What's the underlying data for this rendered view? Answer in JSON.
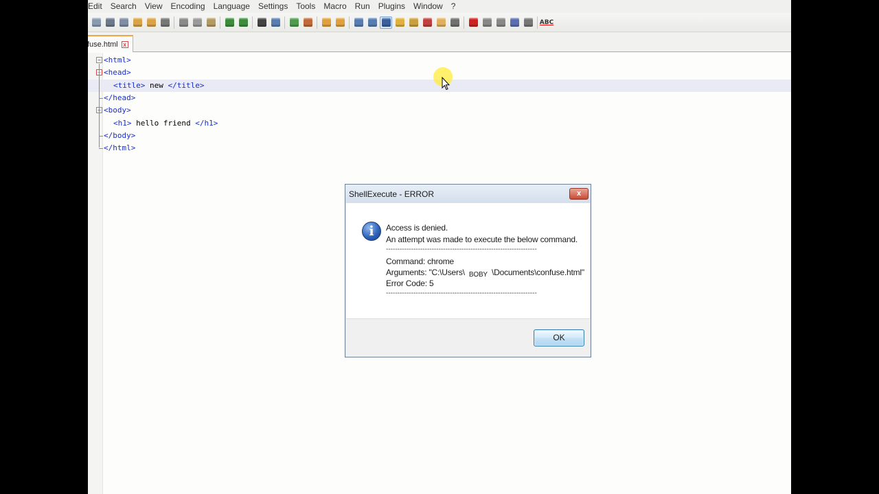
{
  "menu": {
    "items": [
      "Edit",
      "Search",
      "View",
      "Encoding",
      "Language",
      "Settings",
      "Tools",
      "Macro",
      "Run",
      "Plugins",
      "Window",
      "?"
    ]
  },
  "toolbar": {
    "buttons": [
      {
        "icon": "new-file-icon",
        "color": "#8a9bb0"
      },
      {
        "icon": "save-icon",
        "color": "#6c7a8c"
      },
      {
        "icon": "save-all-icon",
        "color": "#7f8ea2"
      },
      {
        "icon": "close-file-icon",
        "color": "#d9a34a"
      },
      {
        "icon": "close-all-icon",
        "color": "#d9a34a"
      },
      {
        "icon": "print-icon",
        "color": "#777777"
      },
      {
        "sep": true
      },
      {
        "icon": "cut-icon",
        "color": "#8a8a8a"
      },
      {
        "icon": "copy-icon",
        "color": "#9a9a9a"
      },
      {
        "icon": "paste-icon",
        "color": "#b59a62"
      },
      {
        "sep": true
      },
      {
        "icon": "undo-icon",
        "color": "#3d8c3d"
      },
      {
        "icon": "redo-icon",
        "color": "#3d8c3d"
      },
      {
        "sep": true
      },
      {
        "icon": "find-icon",
        "color": "#444444"
      },
      {
        "icon": "replace-icon",
        "color": "#5a7db0"
      },
      {
        "sep": true
      },
      {
        "icon": "zoom-in-icon",
        "color": "#4f9a4f"
      },
      {
        "icon": "zoom-out-icon",
        "color": "#c06a3a"
      },
      {
        "sep": true
      },
      {
        "icon": "sync-vertical-icon",
        "color": "#e0a040"
      },
      {
        "icon": "sync-horizontal-icon",
        "color": "#e0a040"
      },
      {
        "sep": true
      },
      {
        "icon": "word-wrap-icon",
        "color": "#5a7db0"
      },
      {
        "icon": "show-all-chars-icon",
        "color": "#5a7db0"
      },
      {
        "icon": "indent-guide-icon",
        "color": "#3a5f9a",
        "active": true
      },
      {
        "icon": "user-language-icon",
        "color": "#e0b040"
      },
      {
        "icon": "doc-map-icon",
        "color": "#c9a040"
      },
      {
        "icon": "function-list-icon",
        "color": "#c04040"
      },
      {
        "icon": "folder-workspace-icon",
        "color": "#e0b060"
      },
      {
        "icon": "monitoring-icon",
        "color": "#707070"
      },
      {
        "sep": true
      },
      {
        "icon": "record-macro-icon",
        "color": "#cc2222"
      },
      {
        "icon": "stop-macro-icon",
        "color": "#888888"
      },
      {
        "icon": "play-macro-icon",
        "color": "#888888"
      },
      {
        "icon": "run-macro-multiple-icon",
        "color": "#5a6fb0"
      },
      {
        "icon": "save-macro-icon",
        "color": "#777777"
      },
      {
        "sep": true
      },
      {
        "icon": "spell-check-icon",
        "text": "ABC"
      }
    ]
  },
  "tab": {
    "label": "fuse.html",
    "close": "x"
  },
  "editor": {
    "lines": [
      {
        "indent": false,
        "parts": [
          [
            "tag",
            "<html>"
          ]
        ],
        "fold": "box"
      },
      {
        "indent": false,
        "parts": [
          [
            "tag",
            "<head>"
          ]
        ],
        "fold": "box-red"
      },
      {
        "indent": true,
        "parts": [
          [
            "tag",
            "<title>"
          ],
          [
            "txt",
            " new "
          ],
          [
            "tag",
            "</title>"
          ]
        ],
        "current": true
      },
      {
        "indent": false,
        "parts": [
          [
            "tag",
            "</head>"
          ]
        ],
        "fold": "end"
      },
      {
        "indent": false,
        "parts": [
          [
            "tag",
            "<body>"
          ]
        ],
        "fold": "box"
      },
      {
        "indent": true,
        "parts": [
          [
            "tag",
            "<h1>"
          ],
          [
            "txt",
            " hello friend "
          ],
          [
            "tag",
            "</h1>"
          ]
        ]
      },
      {
        "indent": false,
        "parts": [
          [
            "tag",
            "</body>"
          ]
        ],
        "fold": "end"
      },
      {
        "indent": false,
        "parts": [
          [
            "tag",
            "</html>"
          ]
        ],
        "fold": "end-last"
      }
    ]
  },
  "dialog": {
    "title": "ShellExecute - ERROR",
    "close": "x",
    "line1": "Access is denied.",
    "line2": "An attempt was made to execute the below command.",
    "dashes": "------------------------------------------------------------------",
    "command": "Command: chrome",
    "arguments_prefix": "Arguments: \"C:\\Users\\",
    "arguments_user": "BOBY",
    "arguments_suffix": "\\Documents\\confuse.html\"",
    "error_code": "Error Code: 5",
    "ok_label": "OK"
  }
}
